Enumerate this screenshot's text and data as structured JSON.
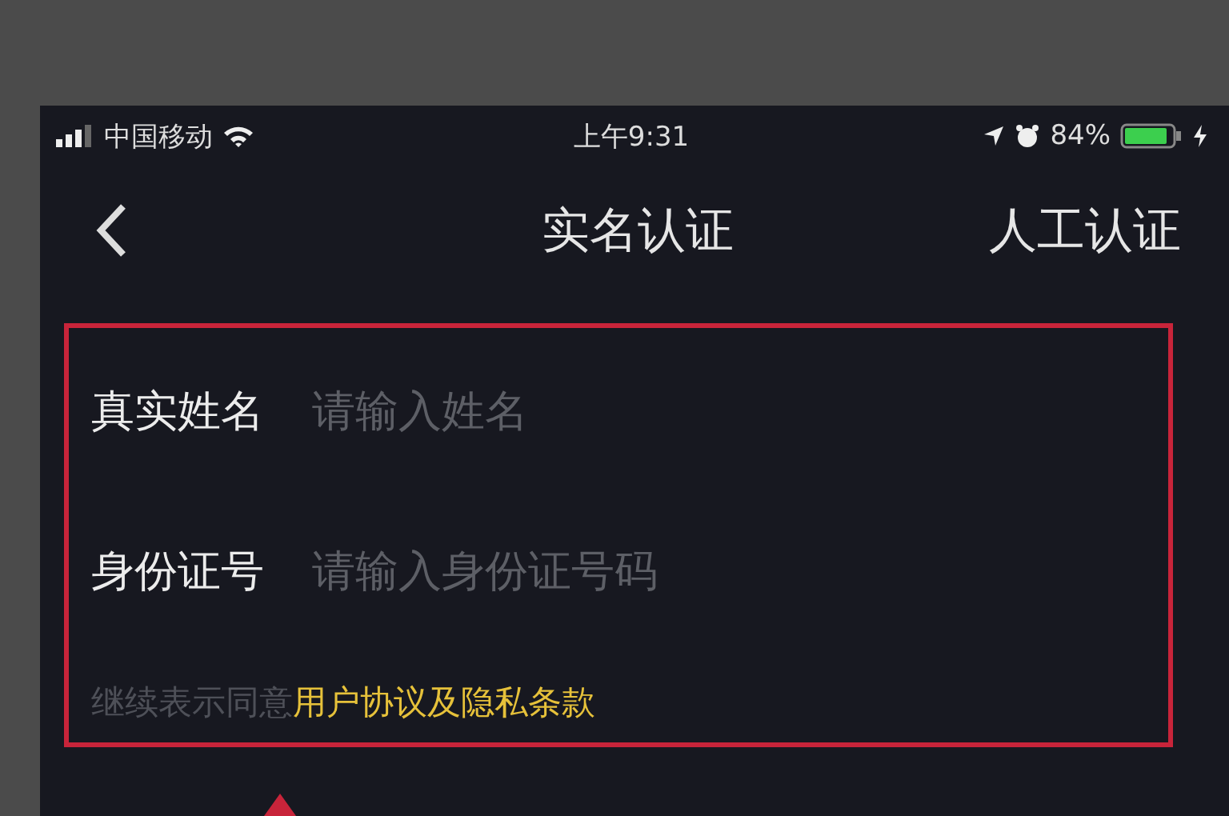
{
  "status_bar": {
    "carrier": "中国移动",
    "time": "上午9:31",
    "battery": "84%"
  },
  "nav_bar": {
    "title": "实名认证",
    "action": "人工认证"
  },
  "form_fields": [
    {
      "label": "真实姓名",
      "placeholder": "请输入姓名"
    },
    {
      "label": "身份证号",
      "placeholder": "请输入身份证号码"
    }
  ],
  "agreement": {
    "text": "继续表示同意",
    "link": "用户协议及隐私条款"
  }
}
